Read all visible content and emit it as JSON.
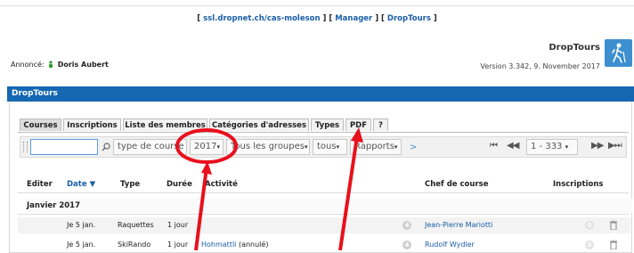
{
  "header": {
    "links": [
      "ssl.dropnet.ch/cas-moleson",
      "Manager",
      "DropTours"
    ],
    "app_name": "DropTours",
    "version": "Version 3.342, 9. November 2017",
    "announced_label": "Annoncé:",
    "announced_user": "Doris Aubert"
  },
  "section_title": "DropTours",
  "tabs": [
    "Courses",
    "Inscriptions",
    "Liste des membres",
    "Catégories d'adresses",
    "Types",
    "PDF",
    "?"
  ],
  "toolbar": {
    "search_value": "",
    "type_filter": "type de course",
    "year": "2017",
    "groups": "Tous les groupes",
    "status": "tous",
    "reports": "Rapports",
    "next": ">",
    "first": "⏮",
    "prev": "◀◀",
    "range": "1 - 333",
    "next_page": "▶▶",
    "last": "▶⏭"
  },
  "columns": [
    "Editer",
    "Date",
    "Type",
    "Durée",
    "Activité",
    "Chef de course",
    "Inscriptions"
  ],
  "month": "Janvier 2017",
  "rows": [
    {
      "date": "Je 5 jan.",
      "type": "Raquettes",
      "duree": "1 jour",
      "activite": "",
      "chef": "Jean-Pierre Mariotti",
      "badge1": "4",
      "badge2": "0"
    },
    {
      "date": "Je 5 jan.",
      "type": "SkiRando",
      "duree": "1 jour",
      "activite_link": "Hohmattli",
      "activite_suffix": " (annulé)",
      "chef": "Rudolf Wydler",
      "badge1": "4",
      "badge2": "0"
    }
  ],
  "colors": {
    "accent": "#1567b2",
    "link": "#1a5ea8",
    "annotation": "#e8101c"
  }
}
